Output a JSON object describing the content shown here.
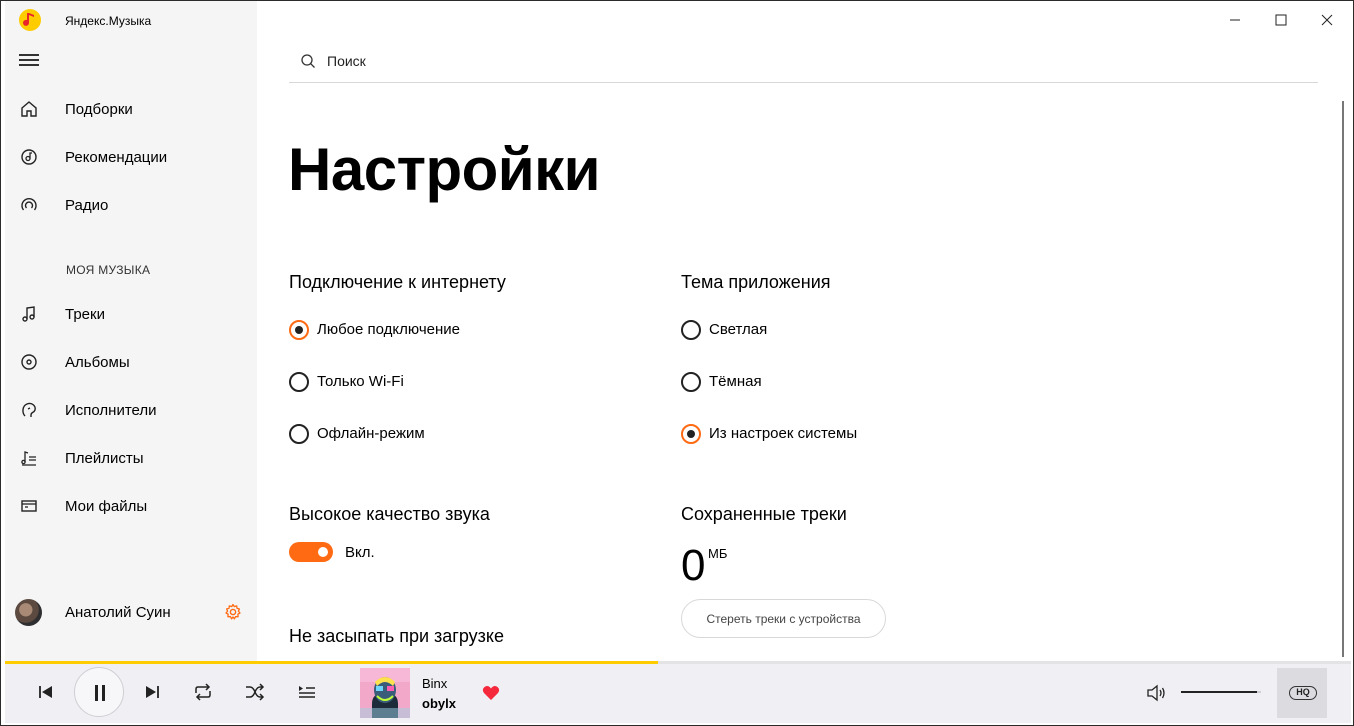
{
  "app": {
    "title": "Яндекс.Музыка"
  },
  "colors": {
    "accent": "#ff6a13",
    "brand_yellow": "#ffcc00",
    "sidebar_bg": "#f5f5f5",
    "player_bg": "#f0eff3"
  },
  "sidebar": {
    "items": [
      {
        "label": "Подборки",
        "icon": "home-icon"
      },
      {
        "label": "Рекомендации",
        "icon": "recommendations-icon"
      },
      {
        "label": "Радио",
        "icon": "radio-icon"
      }
    ],
    "section_label": "МОЯ МУЗЫКА",
    "my_music": [
      {
        "label": "Треки",
        "icon": "music-note-icon"
      },
      {
        "label": "Альбомы",
        "icon": "album-icon"
      },
      {
        "label": "Исполнители",
        "icon": "artist-icon"
      },
      {
        "label": "Плейлисты",
        "icon": "playlist-icon"
      },
      {
        "label": "Мои файлы",
        "icon": "folder-icon"
      }
    ],
    "user": {
      "name": "Анатолий Суин"
    }
  },
  "search": {
    "placeholder": "Поиск"
  },
  "settings": {
    "title": "Настройки",
    "connection": {
      "title": "Подключение к интернету",
      "options": [
        "Любое подключение",
        "Только Wi-Fi",
        "Офлайн-режим"
      ],
      "selected": 0
    },
    "theme": {
      "title": "Тема приложения",
      "options": [
        "Светлая",
        "Тёмная",
        "Из настроек системы"
      ],
      "selected": 2
    },
    "hq_sound": {
      "title": "Высокое качество звука",
      "state_label": "Вкл.",
      "enabled": true
    },
    "saved_tracks": {
      "title": "Сохраненные треки",
      "value": "0",
      "unit": "МБ",
      "clear_button": "Стереть треки с устройства"
    },
    "no_sleep": {
      "title": "Не засыпать при загрузке"
    }
  },
  "player": {
    "track": {
      "title": "Binx",
      "artist": "obylx"
    },
    "progress": 0.485,
    "volume": 0.95,
    "liked": true,
    "hq_label": "HQ"
  }
}
